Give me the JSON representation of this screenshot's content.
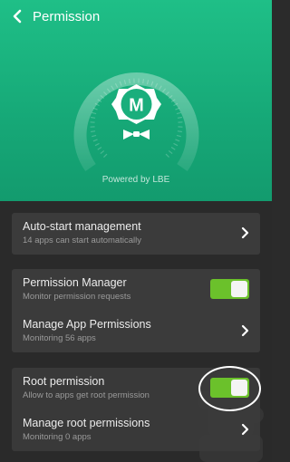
{
  "header": {
    "title": "Permission",
    "back_icon": "chevron-left-icon"
  },
  "hero": {
    "logo_letter": "M",
    "powered_by": "Powered by LBE",
    "accent_color": "#1fbf87"
  },
  "autostart": {
    "label": "Auto-start management",
    "sublabel": "14 apps can start automatically"
  },
  "permission_manager": {
    "label": "Permission Manager",
    "sublabel": "Monitor permission requests",
    "toggle_on": true
  },
  "manage_app_permissions": {
    "label": "Manage App Permissions",
    "sublabel": "Monitoring 56 apps"
  },
  "root_permission": {
    "label": "Root permission",
    "sublabel": "Allow to apps get root permission",
    "toggle_on": true
  },
  "manage_root_permissions": {
    "label": "Manage root permissions",
    "sublabel": "Monitoring 0 apps"
  },
  "colors": {
    "toggle_on": "#6bc12b",
    "card_bg": "#3b3b3b",
    "page_bg": "#2a2a2a"
  }
}
